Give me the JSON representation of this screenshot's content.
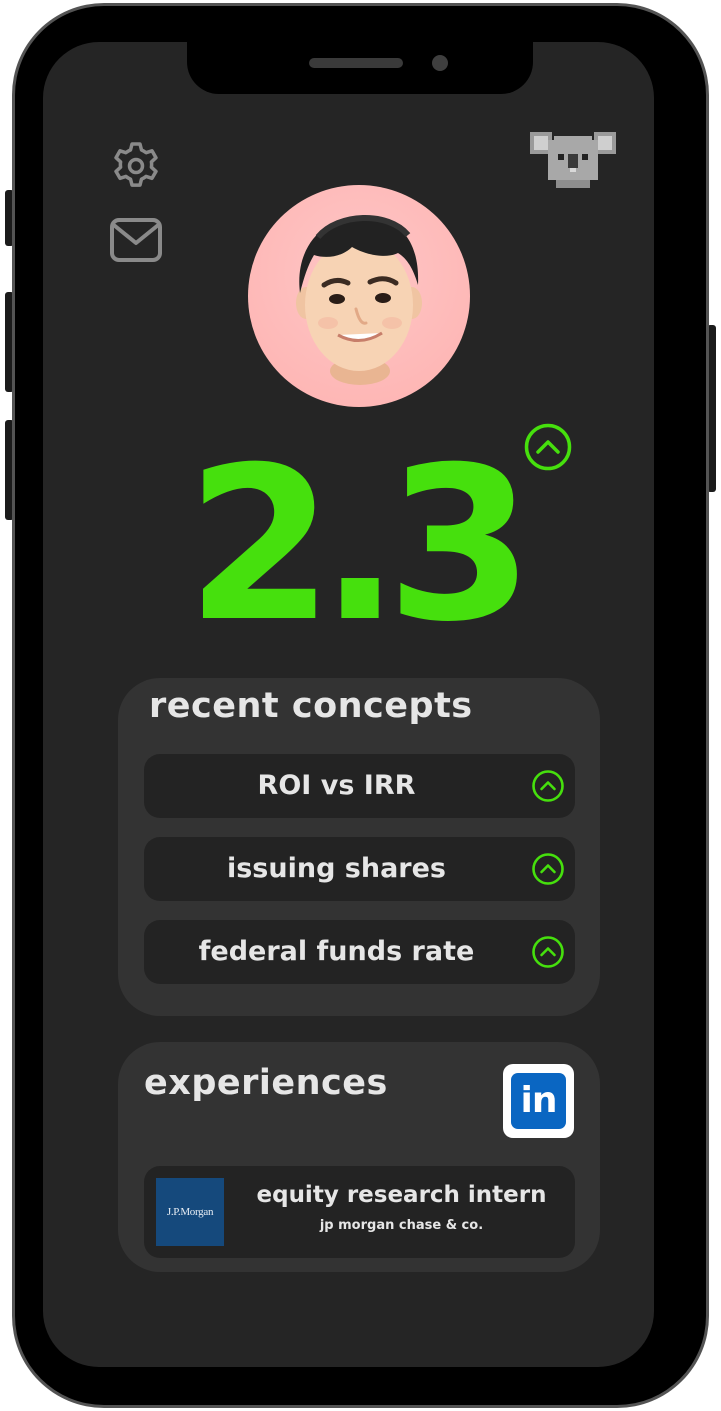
{
  "score": {
    "value": "2.3",
    "trend_icon": "chevron-up-circle-icon",
    "color": "#46e00d"
  },
  "toolbar": {
    "settings_icon": "gear-icon",
    "mail_icon": "mail-icon",
    "mascot_icon": "koala-pixel-icon"
  },
  "profile": {
    "avatar_icon": "memoji-avatar-icon",
    "avatar_bg": "#fdb8b6"
  },
  "concepts": {
    "title": "recent concepts",
    "items": [
      {
        "label": "ROI vs IRR"
      },
      {
        "label": "issuing shares"
      },
      {
        "label": "federal funds rate"
      }
    ]
  },
  "experiences": {
    "title": "experiences",
    "linkedin_label": "in",
    "items": [
      {
        "logo_text": "J.P.Morgan",
        "title": "equity research intern",
        "company": "jp morgan chase & co."
      }
    ]
  },
  "colors": {
    "screen_bg": "#252525",
    "card_bg": "#333333",
    "row_bg": "#232323",
    "accent": "#46e00d",
    "linkedin": "#0a66c2"
  }
}
